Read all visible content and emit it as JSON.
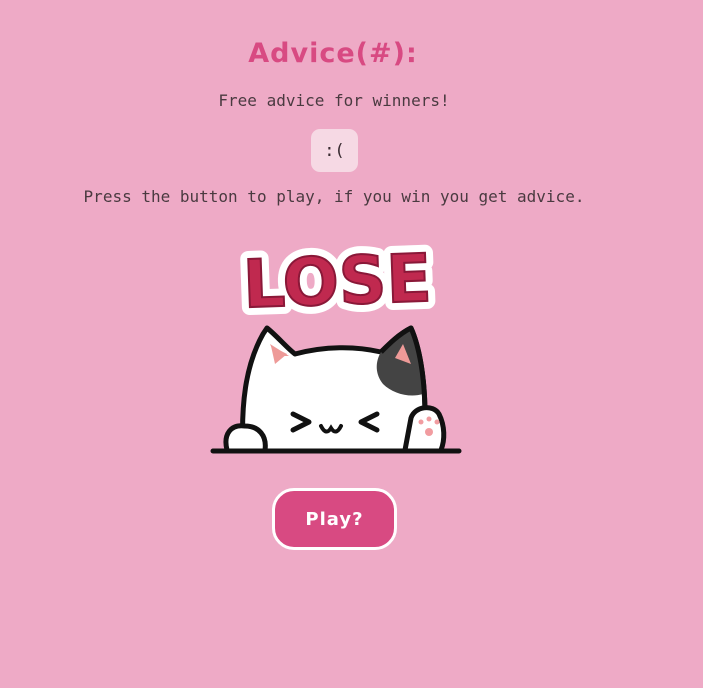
{
  "header": {
    "title": "Advice(#):",
    "subtitle": "Free advice for winners!"
  },
  "result": {
    "face": ":("
  },
  "instructions": "Press the button to play, if you win you get advice.",
  "art": {
    "banner_text": "LOSE",
    "banner_color": "#c0294f",
    "cat_face": ">w<"
  },
  "play_button": {
    "label": "Play?"
  },
  "colors": {
    "background": "#eeaac6",
    "accent": "#d84a82",
    "result_box": "#f6d9e4"
  }
}
